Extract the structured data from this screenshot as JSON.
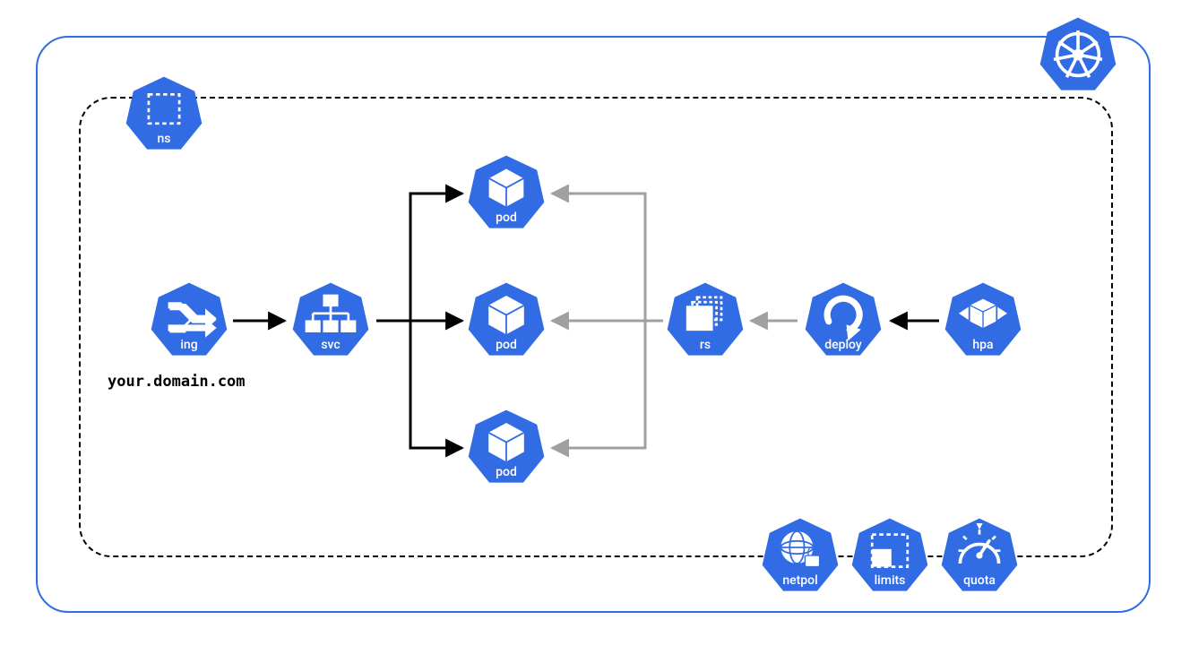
{
  "diagram": {
    "domain_caption": "your.domain.com",
    "nodes": {
      "ns": {
        "label": "ns"
      },
      "ing": {
        "label": "ing"
      },
      "svc": {
        "label": "svc"
      },
      "pod1": {
        "label": "pod"
      },
      "pod2": {
        "label": "pod"
      },
      "pod3": {
        "label": "pod"
      },
      "rs": {
        "label": "rs"
      },
      "deploy": {
        "label": "deploy"
      },
      "hpa": {
        "label": "hpa"
      },
      "netpol": {
        "label": "netpol"
      },
      "limits": {
        "label": "limits"
      },
      "quota": {
        "label": "quota"
      }
    },
    "colors": {
      "k8s_blue": "#326CE5",
      "arrow_black": "#000000",
      "arrow_gray": "#A0A0A0"
    },
    "connections": [
      {
        "from": "ing",
        "to": "svc",
        "color": "black"
      },
      {
        "from": "svc",
        "to": "pod1",
        "color": "black"
      },
      {
        "from": "svc",
        "to": "pod2",
        "color": "black"
      },
      {
        "from": "svc",
        "to": "pod3",
        "color": "black"
      },
      {
        "from": "rs",
        "to": "pod1",
        "color": "gray"
      },
      {
        "from": "rs",
        "to": "pod2",
        "color": "gray"
      },
      {
        "from": "rs",
        "to": "pod3",
        "color": "gray"
      },
      {
        "from": "deploy",
        "to": "rs",
        "color": "gray"
      },
      {
        "from": "hpa",
        "to": "deploy",
        "color": "black"
      }
    ]
  }
}
